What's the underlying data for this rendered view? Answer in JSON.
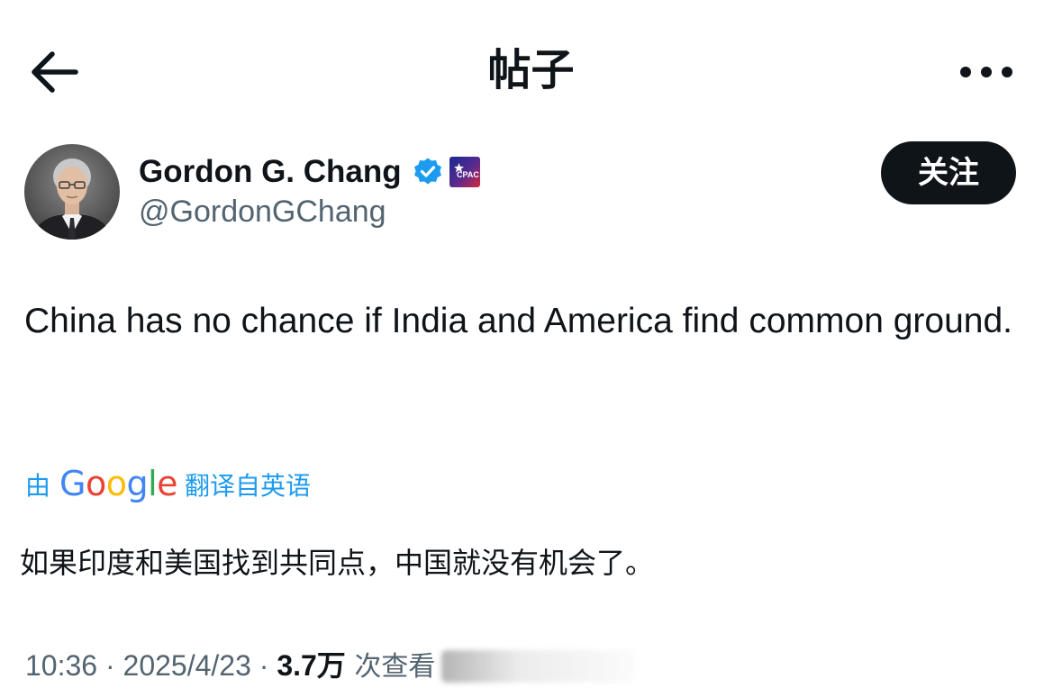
{
  "header": {
    "title": "帖子",
    "back_icon": "arrow-left-icon",
    "more_icon": "more-horizontal-icon"
  },
  "author": {
    "display_name": "Gordon G. Chang",
    "handle": "@GordonGChang",
    "verified_icon": "verified-badge-icon",
    "affiliation_icon": "cpac-badge-icon",
    "follow_label": "关注"
  },
  "tweet": {
    "text": "China has no chance if India and America find common ground.",
    "translation": {
      "by_prefix": "由",
      "provider": "Google",
      "from_label": "翻译自英语",
      "text": "如果印度和美国找到共同点，中国就没有机会了。"
    }
  },
  "meta": {
    "time": "10:36",
    "separator": " · ",
    "date": "2025/4/23",
    "views_count": "3.7万",
    "views_label": " 次查看"
  },
  "colors": {
    "text_primary": "#0f1419",
    "text_secondary": "#536471",
    "link_blue": "#1d9bf0",
    "follow_button_bg": "#0f1419",
    "google_blue": "#4285F4",
    "google_red": "#EA4335",
    "google_yellow": "#FBBC05",
    "google_green": "#34A853"
  }
}
